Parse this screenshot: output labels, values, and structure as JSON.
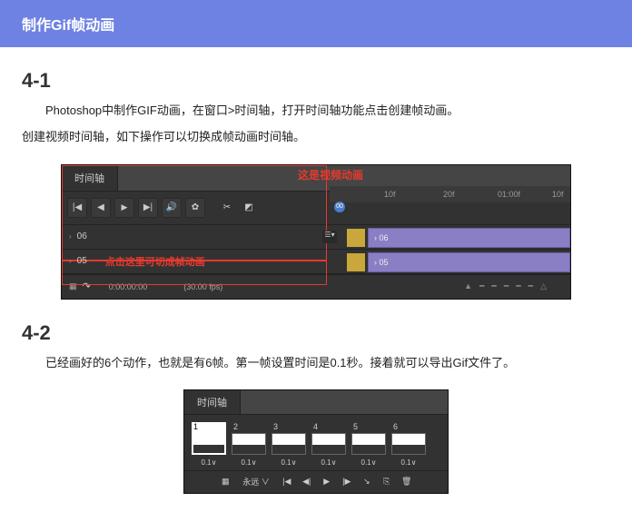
{
  "header": {
    "title": "制作Gif帧动画"
  },
  "section1": {
    "num": "4-1",
    "p1": "Photoshop中制作GIF动画，在窗口>时间轴，打开时间轴功能点击创建帧动画。",
    "p2": "创建视频时间轴，如下操作可以切换成帧动画时间轴。"
  },
  "timeline1": {
    "tab": "时间轴",
    "anno_top": "这是视频动画",
    "anno_bottom": "点击这里可切成帧动画",
    "ruler": {
      "t1": "10f",
      "t2": "20f",
      "t3": "01:00f",
      "t4": "10f"
    },
    "playhead": "00",
    "toolbar": {
      "first": "|◀",
      "prev": "◀",
      "play": "▶",
      "next": "▶|",
      "sound": "🔊",
      "gear": "✿",
      "scissors": "✂",
      "trans": "◩"
    },
    "tracks": [
      {
        "chev": "›",
        "name": "06",
        "clip_label": "› 06"
      },
      {
        "chev": "›",
        "name": "05",
        "clip_label": "› 05"
      }
    ],
    "track_menu": "☰▾",
    "bottom": {
      "redo": "↷",
      "timecode": "0:00:00:00",
      "fps": "(30.00 fps)"
    }
  },
  "section2": {
    "num": "4-2",
    "p1": "已经画好的6个动作，也就是有6帧。第一帧设置时间是0.1秒。接着就可以导出Gif文件了。"
  },
  "timeline2": {
    "tab": "时间轴",
    "frames": [
      {
        "n": "1",
        "d": "0.1∨",
        "sel": true
      },
      {
        "n": "2",
        "d": "0.1∨"
      },
      {
        "n": "3",
        "d": "0.1∨"
      },
      {
        "n": "4",
        "d": "0.1∨"
      },
      {
        "n": "5",
        "d": "0.1∨"
      },
      {
        "n": "6",
        "d": "0.1∨"
      }
    ],
    "bottom": {
      "convert": "▦",
      "loop": "永远 ∨",
      "first": "|◀",
      "prev": "◀|",
      "play": "▶",
      "next": "|▶",
      "tween": "↘",
      "dup": "⎘",
      "trash": "🗑"
    }
  }
}
